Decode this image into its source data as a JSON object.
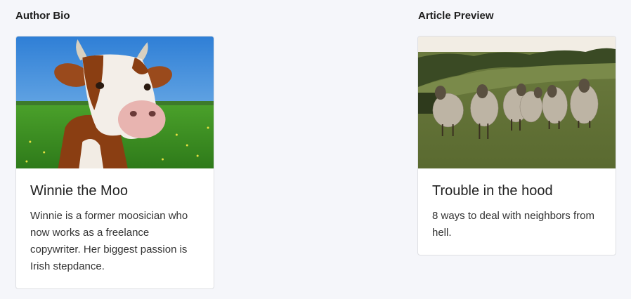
{
  "sections": {
    "author_bio": {
      "heading": "Author Bio"
    },
    "article_preview": {
      "heading": "Article Preview"
    }
  },
  "cards": {
    "author": {
      "image": "cow-photo",
      "title": "Winnie the Moo",
      "text": "Winnie is a former moosician who now works as a freelance copywriter. Her biggest passion is Irish stepdance."
    },
    "article": {
      "image": "sheep-photo",
      "title": "Trouble in the hood",
      "text": "8 ways to deal with neighbors from hell."
    }
  }
}
